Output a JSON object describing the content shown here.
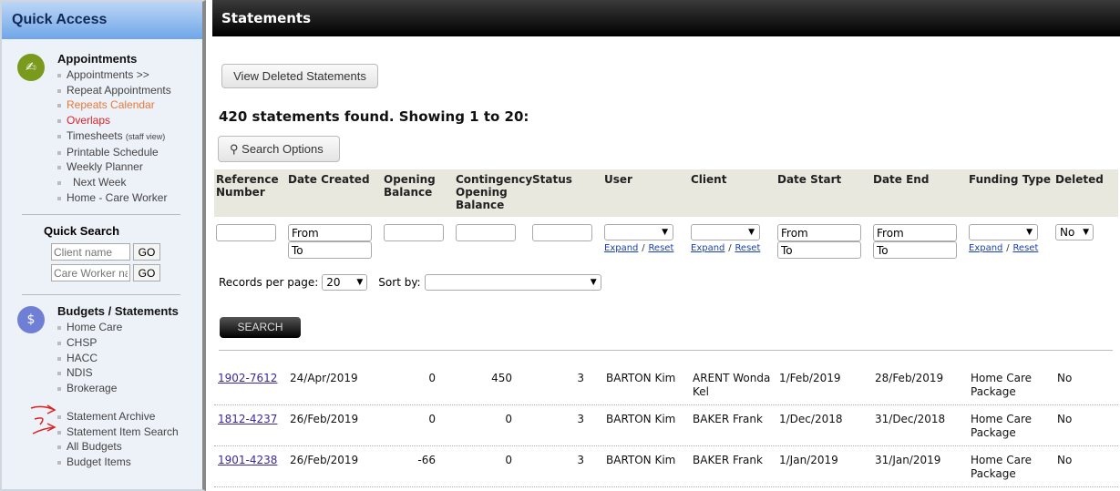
{
  "sidebar": {
    "title": "Quick Access",
    "appointments": {
      "title": "Appointments",
      "items": [
        "Appointments >>",
        "Repeat Appointments",
        "Repeats Calendar",
        "Overlaps",
        "Timesheets",
        "Printable Schedule",
        "Weekly Planner",
        "Next Week",
        "Home - Care Worker"
      ],
      "timesheets_note": "(staff view)"
    },
    "quick_search": {
      "title": "Quick Search",
      "client_placeholder": "Client name",
      "worker_placeholder": "Care Worker name",
      "go": "GO"
    },
    "budgets": {
      "title": "Budgets / Statements",
      "items": [
        "Home Care",
        "CHSP",
        "HACC",
        "NDIS",
        "Brokerage"
      ],
      "items2": [
        "Statement Archive",
        "Statement Item Search",
        "All Budgets",
        "Budget Items"
      ]
    }
  },
  "main": {
    "title": "Statements",
    "view_deleted": "View Deleted Statements",
    "found": "420 statements found. Showing 1 to 20:",
    "search_options": "Search Options",
    "columns": [
      "Reference Number",
      "Date Created",
      "Opening Balance",
      "Contingency Opening Balance",
      "Status",
      "User",
      "Client",
      "Date Start",
      "Date End",
      "Funding Type",
      "Deleted"
    ],
    "filters": {
      "from": "From",
      "to": "To",
      "expand": "Expand",
      "reset": "Reset",
      "deleted": "No"
    },
    "records_label": "Records per page:",
    "records_value": "20",
    "sort_label": "Sort by:",
    "sort_value": "",
    "search": "SEARCH",
    "rows": [
      [
        "1902-7612",
        "24/Apr/2019",
        "0",
        "450",
        "3",
        "BARTON Kim",
        "ARENT Wonda Kel",
        "1/Feb/2019",
        "28/Feb/2019",
        "Home Care Package",
        "No"
      ],
      [
        "1812-4237",
        "26/Feb/2019",
        "0",
        "0",
        "3",
        "BARTON Kim",
        "BAKER Frank",
        "1/Dec/2018",
        "31/Dec/2018",
        "Home Care Package",
        "No"
      ],
      [
        "1901-4238",
        "26/Feb/2019",
        "-66",
        "0",
        "3",
        "BARTON Kim",
        "BAKER Frank",
        "1/Jan/2019",
        "31/Jan/2019",
        "Home Care Package",
        "No"
      ]
    ]
  }
}
